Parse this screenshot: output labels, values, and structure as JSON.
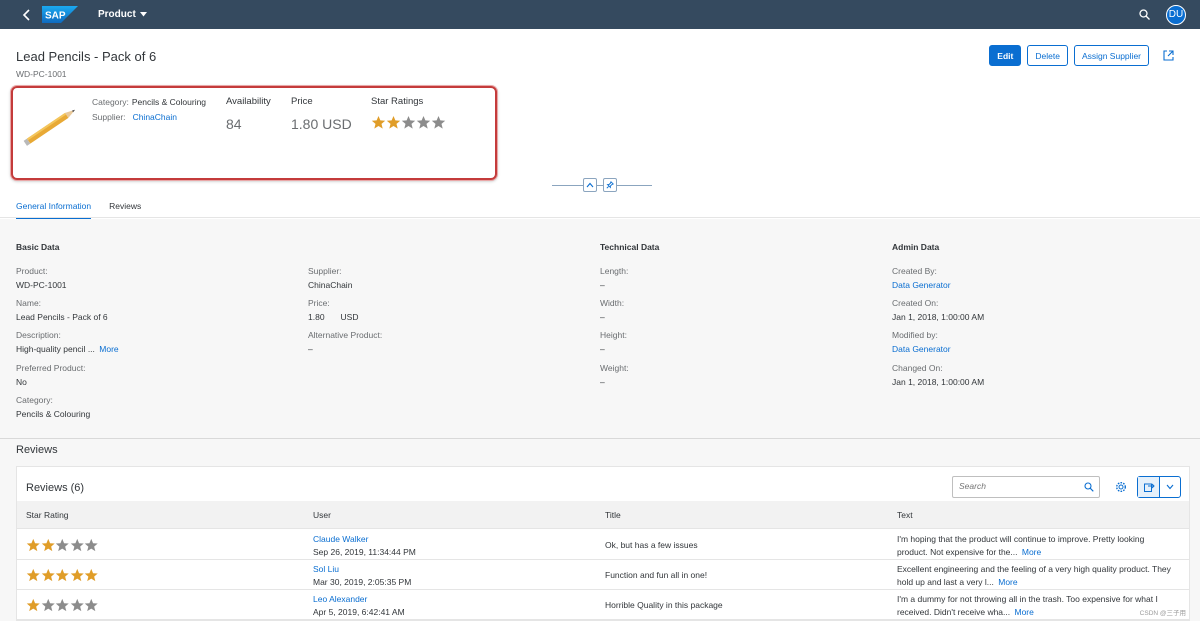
{
  "shell": {
    "logo": "SAP",
    "title": "Product",
    "avatar": "DU"
  },
  "header": {
    "title": "Lead Pencils - Pack of 6",
    "subtitle": "WD-PC-1001",
    "actions": {
      "edit": "Edit",
      "delete": "Delete",
      "assign": "Assign Supplier"
    },
    "category_label": "Category:",
    "category_value": "Pencils & Colouring",
    "supplier_label": "Supplier:",
    "supplier_value": "ChinaChain",
    "availability_label": "Availability",
    "availability_value": "84",
    "price_label": "Price",
    "price_value": "1.80 USD",
    "rating_label": "Star Ratings",
    "rating_value": 2,
    "rating_max": 5
  },
  "tabs": [
    "General Information",
    "Reviews"
  ],
  "basic": {
    "title": "Basic Data",
    "product_label": "Product:",
    "product_value": "WD-PC-1001",
    "name_label": "Name:",
    "name_value": "Lead Pencils - Pack of 6",
    "desc_label": "Description:",
    "desc_value": "High-quality pencil ...",
    "more": "More",
    "preferred_label": "Preferred Product:",
    "preferred_value": "No",
    "category_label": "Category:",
    "category_value": "Pencils & Colouring",
    "supplier_label": "Supplier:",
    "supplier_value": "ChinaChain",
    "price_label": "Price:",
    "price_value": "1.80",
    "price_currency": "USD",
    "alt_label": "Alternative Product:",
    "alt_value": "–"
  },
  "technical": {
    "title": "Technical Data",
    "length_label": "Length:",
    "length_value": "–",
    "width_label": "Width:",
    "width_value": "–",
    "height_label": "Height:",
    "height_value": "–",
    "weight_label": "Weight:",
    "weight_value": "–"
  },
  "admin": {
    "title": "Admin Data",
    "created_by_label": "Created By:",
    "created_by_value": "Data Generator",
    "created_on_label": "Created On:",
    "created_on_value": "Jan 1, 2018, 1:00:00 AM",
    "modified_by_label": "Modified by:",
    "modified_by_value": "Data Generator",
    "changed_on_label": "Changed On:",
    "changed_on_value": "Jan 1, 2018, 1:00:00 AM"
  },
  "reviews": {
    "section_title": "Reviews",
    "table_title": "Reviews (6)",
    "search_placeholder": "Search",
    "columns": [
      "Star Rating",
      "User",
      "Title",
      "Text"
    ],
    "rows": [
      {
        "rating": 2,
        "user": "Claude Walker",
        "date": "Sep 26, 2019, 11:34:44 PM",
        "title": "Ok, but has a few issues",
        "text1": "I'm hoping that the product will continue to improve. Pretty looking",
        "text2": "product. Not expensive for the...",
        "more": "More"
      },
      {
        "rating": 5,
        "user": "Sol Liu",
        "date": "Mar 30, 2019, 2:05:35 PM",
        "title": "Function and fun all in one!",
        "text1": "Excellent engineering and the feeling of a very high quality product. They",
        "text2": "hold up and last a very l...",
        "more": "More"
      },
      {
        "rating": 1,
        "user": "Leo Alexander",
        "date": "Apr 5, 2019, 6:42:41 AM",
        "title": "Horrible Quality in this package",
        "text1": "I'm a dummy for not throwing all in the trash. Too expensive for what I",
        "text2": "received. Didn't receive wha...",
        "more": "More"
      }
    ]
  },
  "watermark": "CSDN @三子用",
  "colors": {
    "shell": "#354a5f",
    "accent": "#0a6ed1",
    "star_filled": "#e09d28",
    "star_empty": "#8c8c8c",
    "highlight": "#c43b3b"
  }
}
